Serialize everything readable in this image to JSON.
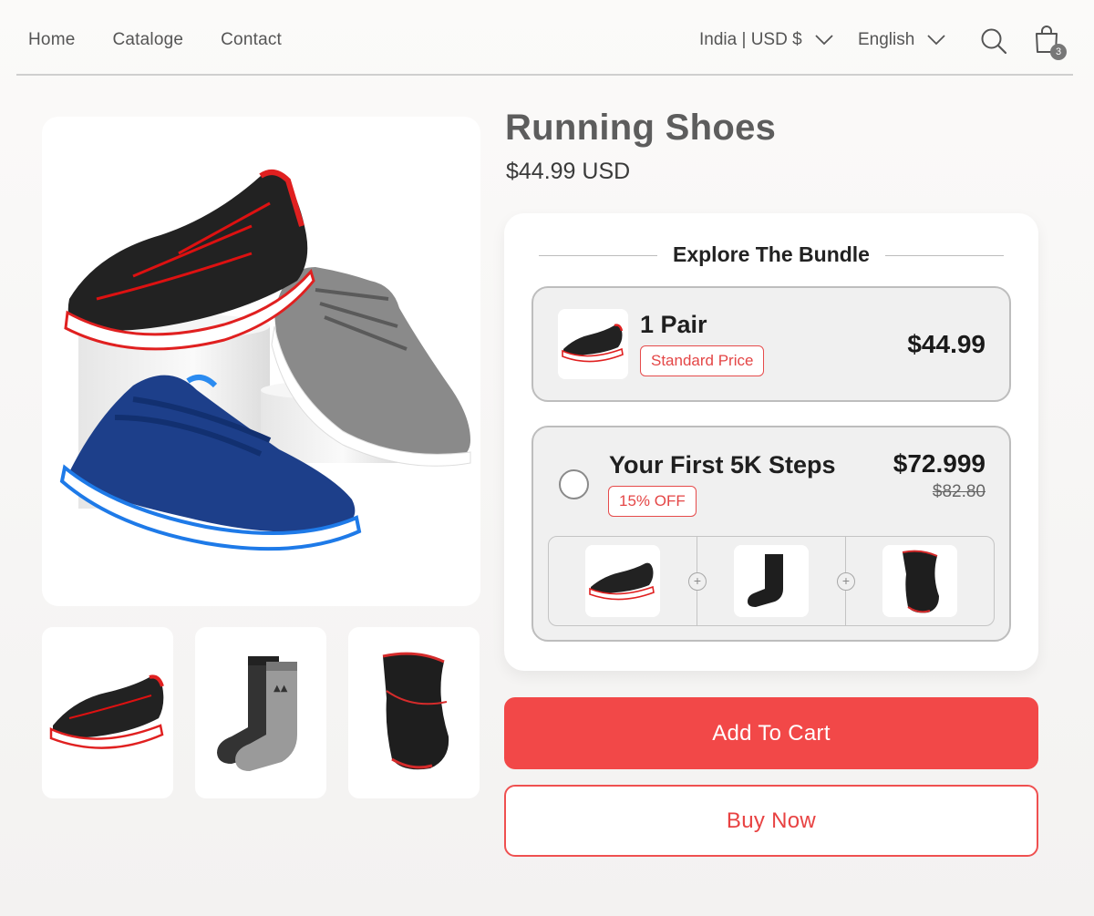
{
  "nav": {
    "items": [
      "Home",
      "Cataloge",
      "Contact"
    ]
  },
  "header": {
    "region": "India | USD $",
    "language": "English",
    "cart_count": "3",
    "icons": [
      "chevron-down-icon",
      "search-icon",
      "shopping-bag-icon"
    ]
  },
  "product": {
    "title": "Running Shoes",
    "price": "$44.99 USD"
  },
  "bundle": {
    "heading": "Explore The Bundle",
    "option1": {
      "title": "1 Pair",
      "tag": "Standard Price",
      "price": "$44.99"
    },
    "option2": {
      "title": "Your First 5K Steps",
      "tag": "15% OFF",
      "price": "$72.999",
      "old_price": "$82.80",
      "plus": "+"
    }
  },
  "actions": {
    "add_to_cart": "Add To Cart",
    "buy_now": "Buy Now"
  },
  "colors": {
    "accent": "#f24848",
    "tag_red": "#e44646",
    "text_gray": "#555555"
  }
}
